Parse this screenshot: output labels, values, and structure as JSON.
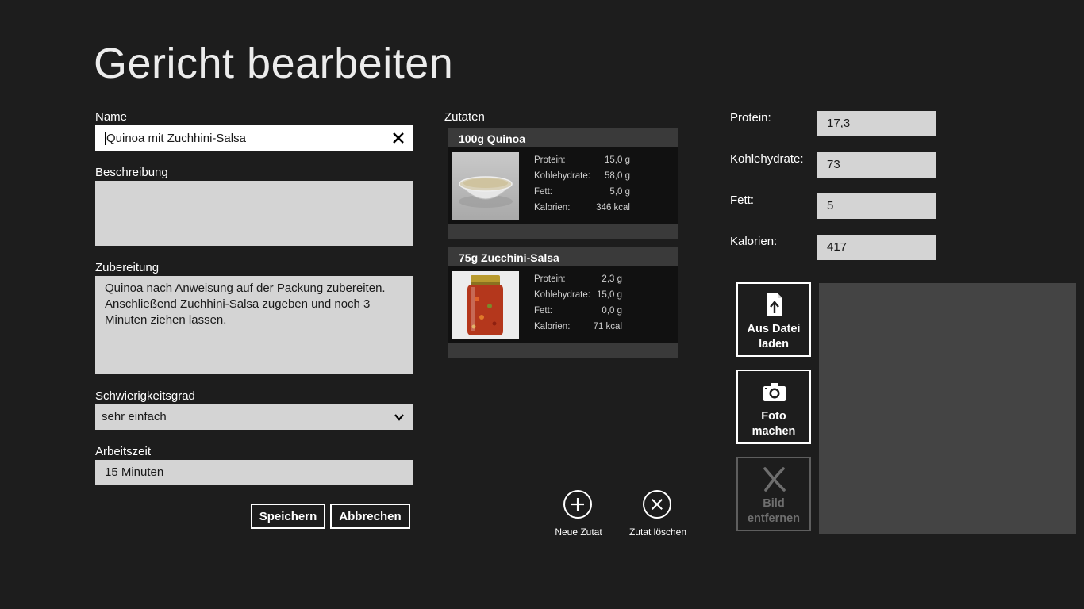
{
  "page": {
    "title": "Gericht bearbeiten"
  },
  "form": {
    "name_label": "Name",
    "name_value": "Quinoa mit Zuchhini-Salsa",
    "description_label": "Beschreibung",
    "description_value": "",
    "preparation_label": "Zubereitung",
    "preparation_value": "Quinoa nach Anweisung auf der Packung zubereiten. Anschließend Zuchhini-Salsa zugeben und noch 3 Minuten ziehen lassen.",
    "difficulty_label": "Schwierigkeitsgrad",
    "difficulty_value": "sehr einfach",
    "worktime_label": "Arbeitszeit",
    "worktime_value": "15 Minuten",
    "save_label": "Speichern",
    "cancel_label": "Abbrechen"
  },
  "ingredients": {
    "label": "Zutaten",
    "items": [
      {
        "title": "100g Quinoa",
        "image_icon": "quinoa-bowl-photo",
        "nutrients": [
          {
            "name": "Protein:",
            "value": "15,0 g"
          },
          {
            "name": "Kohlehydrate:",
            "value": "58,0 g"
          },
          {
            "name": "Fett:",
            "value": "5,0 g"
          },
          {
            "name": "Kalorien:",
            "value": "346 kcal"
          }
        ]
      },
      {
        "title": "75g Zucchini-Salsa",
        "image_icon": "salsa-jar-photo",
        "nutrients": [
          {
            "name": "Protein:",
            "value": "2,3 g"
          },
          {
            "name": "Kohlehydrate:",
            "value": "15,0 g"
          },
          {
            "name": "Fett:",
            "value": "0,0 g"
          },
          {
            "name": "Kalorien:",
            "value": "71 kcal"
          }
        ]
      }
    ],
    "new_label": "Neue Zutat",
    "delete_label": "Zutat löschen"
  },
  "totals": {
    "protein_label": "Protein:",
    "protein_value": "17,3",
    "carbs_label": "Kohlehydrate:",
    "carbs_value": "73",
    "fat_label": "Fett:",
    "fat_value": "5",
    "calories_label": "Kalorien:",
    "calories_value": "417"
  },
  "image_actions": {
    "load_file_line1": "Aus Datei",
    "load_file_line2": "laden",
    "take_photo_line1": "Foto",
    "take_photo_line2": "machen",
    "remove_line1": "Bild",
    "remove_line2": "entfernen"
  },
  "colors": {
    "background": "#1d1d1d",
    "field": "#d4d4d4",
    "panel": "#3a3a3a",
    "disabled": "#6e6e6e"
  }
}
